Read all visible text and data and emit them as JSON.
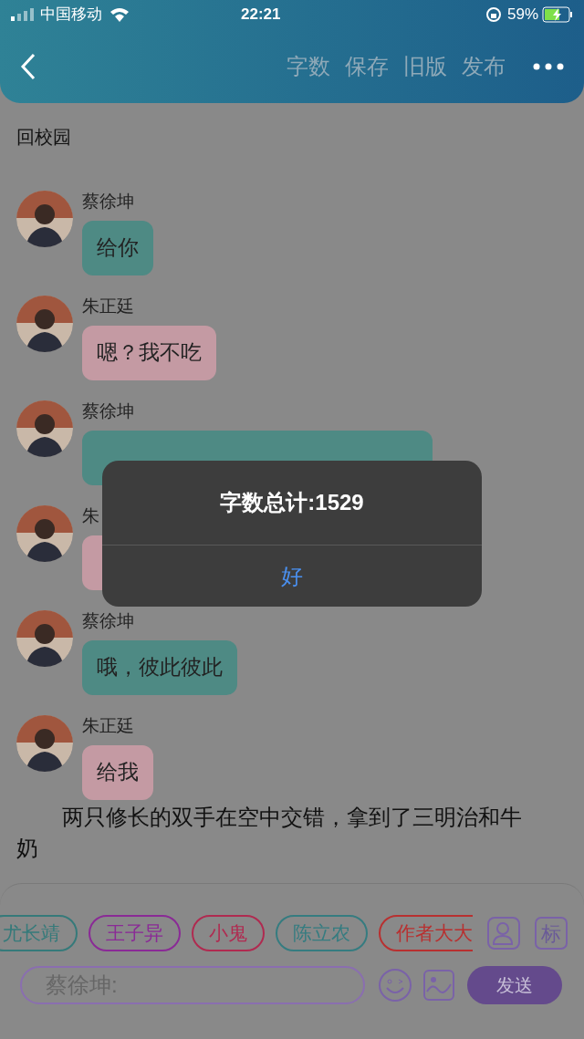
{
  "status_bar": {
    "carrier": "中国移动",
    "time": "22:21",
    "battery": "59%"
  },
  "header": {
    "actions": [
      "字数",
      "保存",
      "旧版",
      "发布"
    ]
  },
  "title": "回校园",
  "messages": [
    {
      "name": "蔡徐坤",
      "text": "给你",
      "color": "#4e8a84"
    },
    {
      "name": "朱正廷",
      "text": "嗯？我不吃",
      "color": "#c49aa3"
    },
    {
      "name": "蔡徐坤",
      "color": "#4e8a84"
    },
    {
      "name": "朱",
      "color": "#c49aa3"
    },
    {
      "name": "蔡徐坤",
      "text": "哦，彼此彼此",
      "color": "#4e8a84"
    },
    {
      "name": "朱正廷",
      "text": "给我",
      "color": "#c49aa3"
    }
  ],
  "paragraph": "两只修长的双手在空中交错，拿到了三明治和牛奶",
  "chips": [
    {
      "label": "尤长靖",
      "color": "#357a7a"
    },
    {
      "label": "王子异",
      "color": "#8a2a96"
    },
    {
      "label": "小鬼",
      "color": "#b02a50"
    },
    {
      "label": "陈立农",
      "color": "#357c80"
    },
    {
      "label": "作者大大",
      "color": "#b83030"
    }
  ],
  "tag_button": "标",
  "input": {
    "placeholder": "蔡徐坤:"
  },
  "send_button": "发送",
  "dialog": {
    "message": "字数总计:1529",
    "button": "好"
  }
}
